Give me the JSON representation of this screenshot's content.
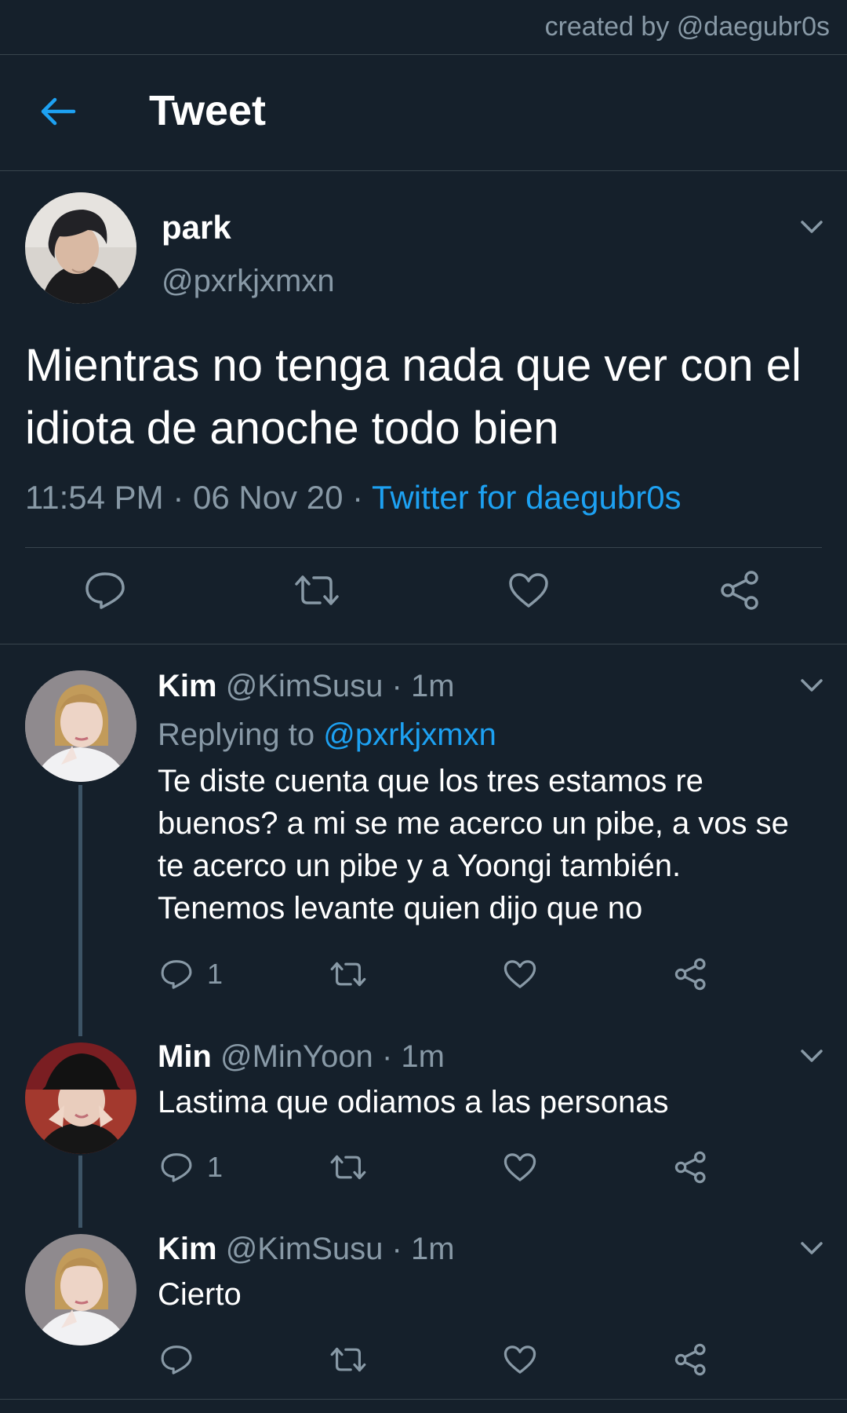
{
  "credit": "created by @daegubr0s",
  "header": {
    "title": "Tweet"
  },
  "main_tweet": {
    "name": "park",
    "handle": "@pxrkjxmxn",
    "text": "Mientras no tenga nada que ver con el idiota de anoche todo bien",
    "time": "11:54 PM",
    "date": "06 Nov 20",
    "source": "Twitter for daegubr0s",
    "separator": " · "
  },
  "replies": [
    {
      "name": "Kim",
      "handle": "@KimSusu",
      "time": "1m",
      "replying_label": "Replying to",
      "replying_to": "@pxrkjxmxn",
      "text": "Te diste cuenta que los tres estamos re buenos? a mi se me acerco un pibe, a vos se te acerco un pibe y a Yoongi también. Tenemos levante quien dijo que no",
      "reply_count": "1"
    },
    {
      "name": "Min",
      "handle": "@MinYoon",
      "time": "1m",
      "text": "Lastima que odiamos a las personas",
      "reply_count": "1"
    },
    {
      "name": "Kim",
      "handle": "@KimSusu",
      "time": "1m",
      "text": "Cierto",
      "reply_count": ""
    }
  ],
  "colors": {
    "background": "#15202b",
    "accent": "#1da1f2",
    "muted": "#8899a6",
    "divider": "#38444d"
  }
}
